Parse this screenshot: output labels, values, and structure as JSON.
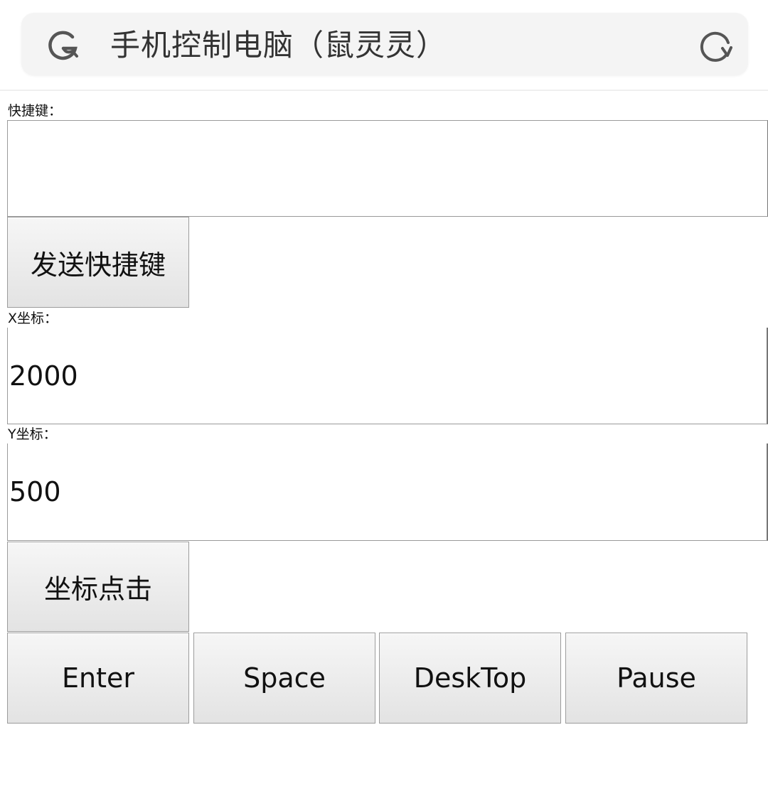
{
  "header": {
    "title": "手机控制电脑（鼠灵灵）",
    "search_icon": "search-icon",
    "refresh_icon": "refresh-icon"
  },
  "shortcut": {
    "label": "快捷键：",
    "value": "",
    "placeholder": "",
    "send_button": "发送快捷键"
  },
  "coords": {
    "x_label": "X坐标：",
    "x_value": "2000",
    "y_label": "Y坐标：",
    "y_value": "500",
    "click_button": "坐标点击"
  },
  "keys": {
    "enter": "Enter",
    "space": "Space",
    "desktop": "DeskTop",
    "pause": "Pause"
  }
}
